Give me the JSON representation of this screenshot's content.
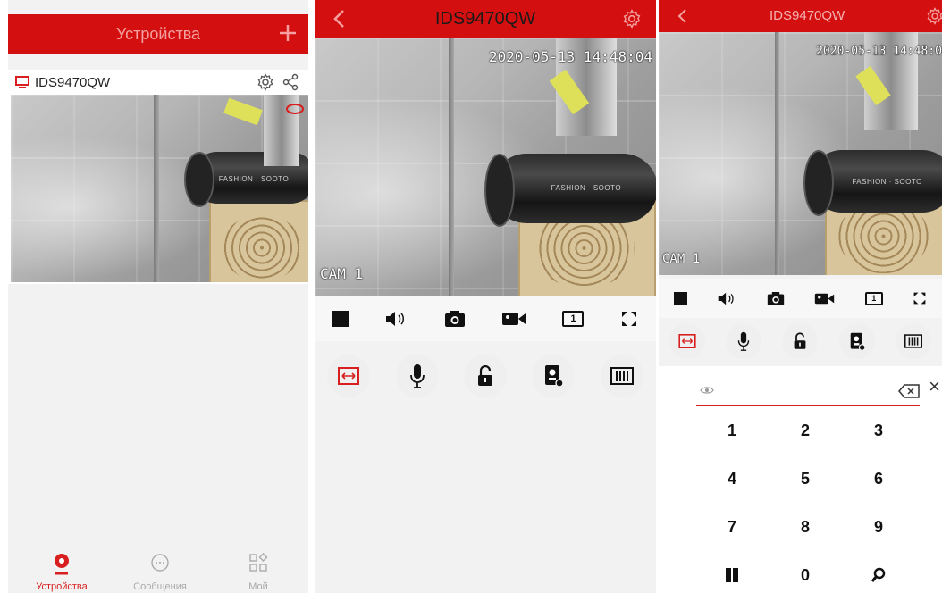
{
  "colors": {
    "accent": "#d40f0f",
    "panel_bg": "#f2f2f2"
  },
  "panel1": {
    "title": "Устройства",
    "add_icon": "plus-icon",
    "device": {
      "name": "IDS9470QW",
      "settings_icon": "gear-icon",
      "share_icon": "share-icon"
    },
    "tabs": [
      {
        "label": "Устройства",
        "icon": "camera-icon",
        "active": true
      },
      {
        "label": "Сообщения",
        "icon": "chat-icon",
        "active": false
      },
      {
        "label": "Мой",
        "icon": "apps-icon",
        "active": false
      }
    ]
  },
  "panel2": {
    "title": "IDS9470QW",
    "timestamp": "2020-05-13 14:48:04",
    "cam_label": "CAM 1",
    "layout_number": "1",
    "controls": [
      "stop-icon",
      "speaker-icon",
      "snapshot-icon",
      "record-icon",
      "layout-icon",
      "fullscreen-icon"
    ],
    "actions": [
      "ptz-icon",
      "microphone-icon",
      "unlock-icon",
      "doorbell-icon",
      "keyboard-icon"
    ]
  },
  "panel3": {
    "title": "IDS9470QW",
    "timestamp": "2020-05-13 14:48:0",
    "cam_label": "CAM 1",
    "layout_number": "1",
    "password_placeholder": "",
    "keys": [
      "1",
      "2",
      "3",
      "4",
      "5",
      "6",
      "7",
      "8",
      "9",
      "",
      "0",
      ""
    ],
    "close_symbol": "×"
  }
}
